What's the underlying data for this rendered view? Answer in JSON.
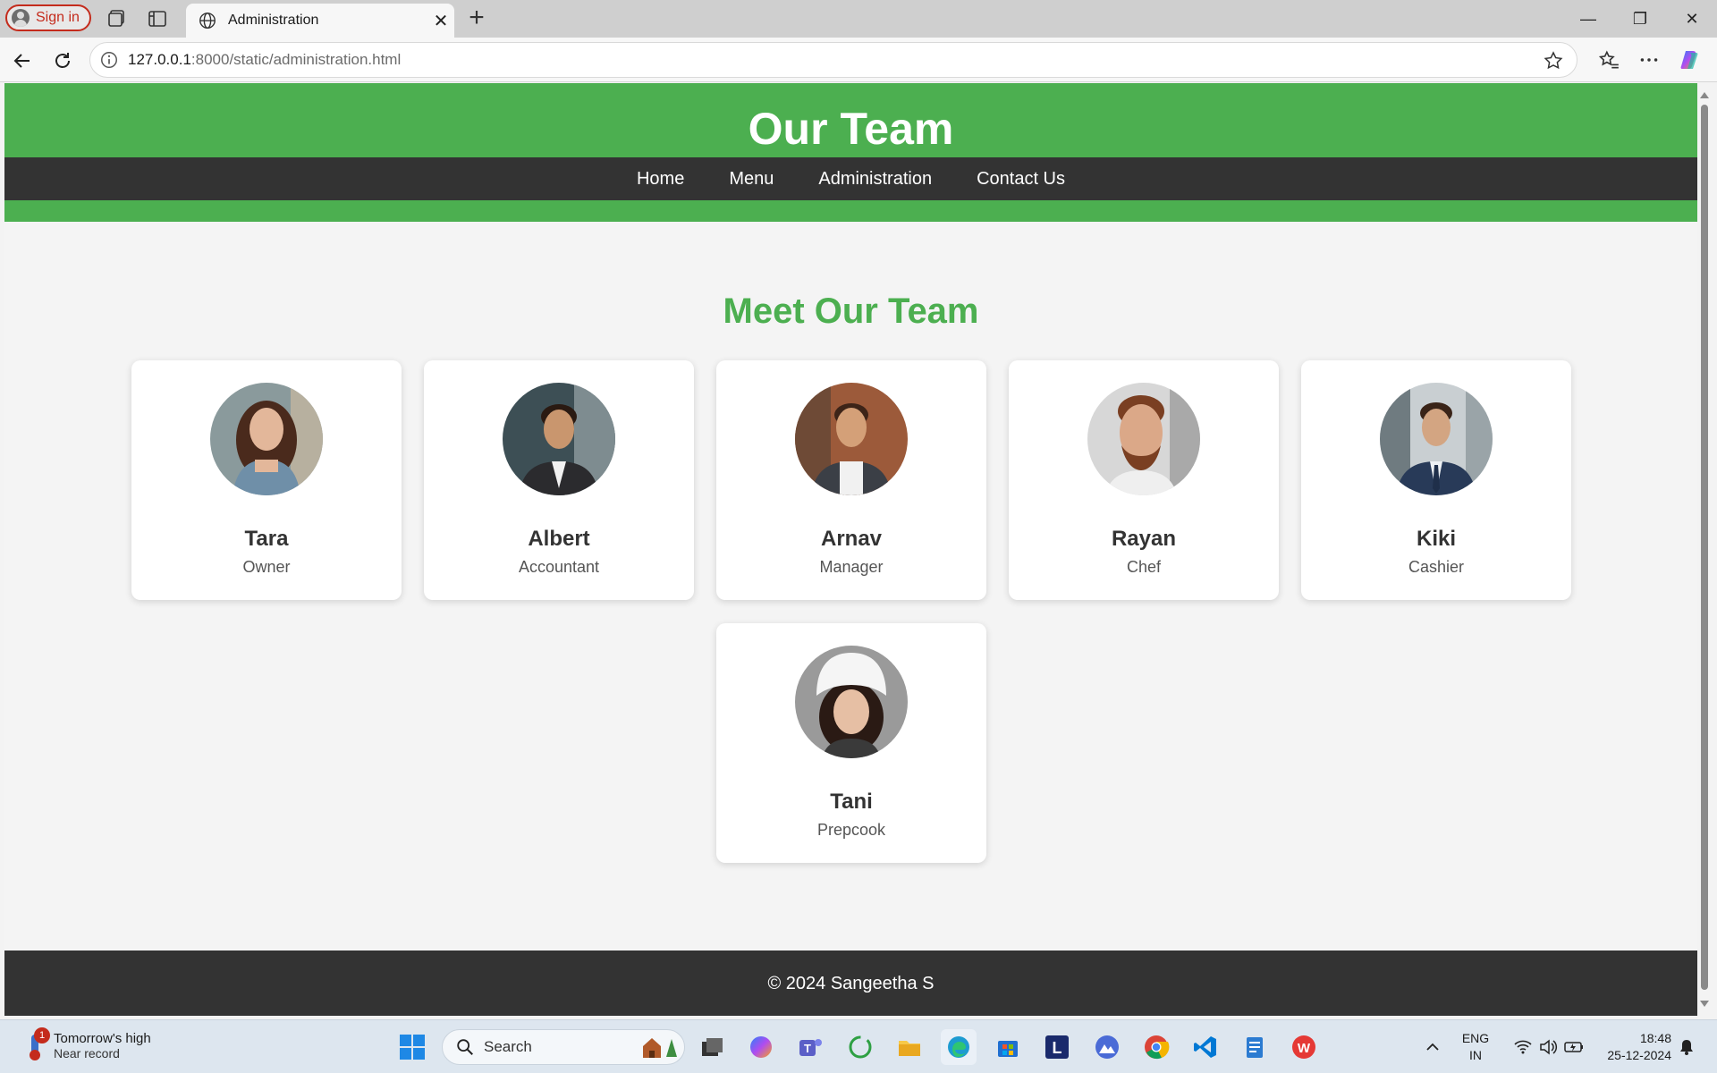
{
  "browser": {
    "signin_label": "Sign in",
    "tab_title": "Administration",
    "url_host": "127.0.0.1",
    "url_rest": ":8000/static/administration.html"
  },
  "site": {
    "title": "Our Team",
    "nav": [
      "Home",
      "Menu",
      "Administration",
      "Contact Us"
    ],
    "section_title": "Meet Our Team",
    "team": [
      {
        "name": "Tara",
        "role": "Owner"
      },
      {
        "name": "Albert",
        "role": "Accountant"
      },
      {
        "name": "Arnav",
        "role": "Manager"
      },
      {
        "name": "Rayan",
        "role": "Chef"
      },
      {
        "name": "Kiki",
        "role": "Cashier"
      },
      {
        "name": "Tani",
        "role": "Prepcook"
      }
    ],
    "footer": "© 2024 Sangeetha S",
    "colors": {
      "header": "#4caf50",
      "nav": "#333333",
      "accent": "#4caf50"
    }
  },
  "taskbar": {
    "weather_badge": "1",
    "weather_title": "Tomorrow's high",
    "weather_sub": "Near record",
    "search_label": "Search",
    "lang_top": "ENG",
    "lang_bottom": "IN",
    "time": "18:48",
    "date": "25-12-2024"
  }
}
